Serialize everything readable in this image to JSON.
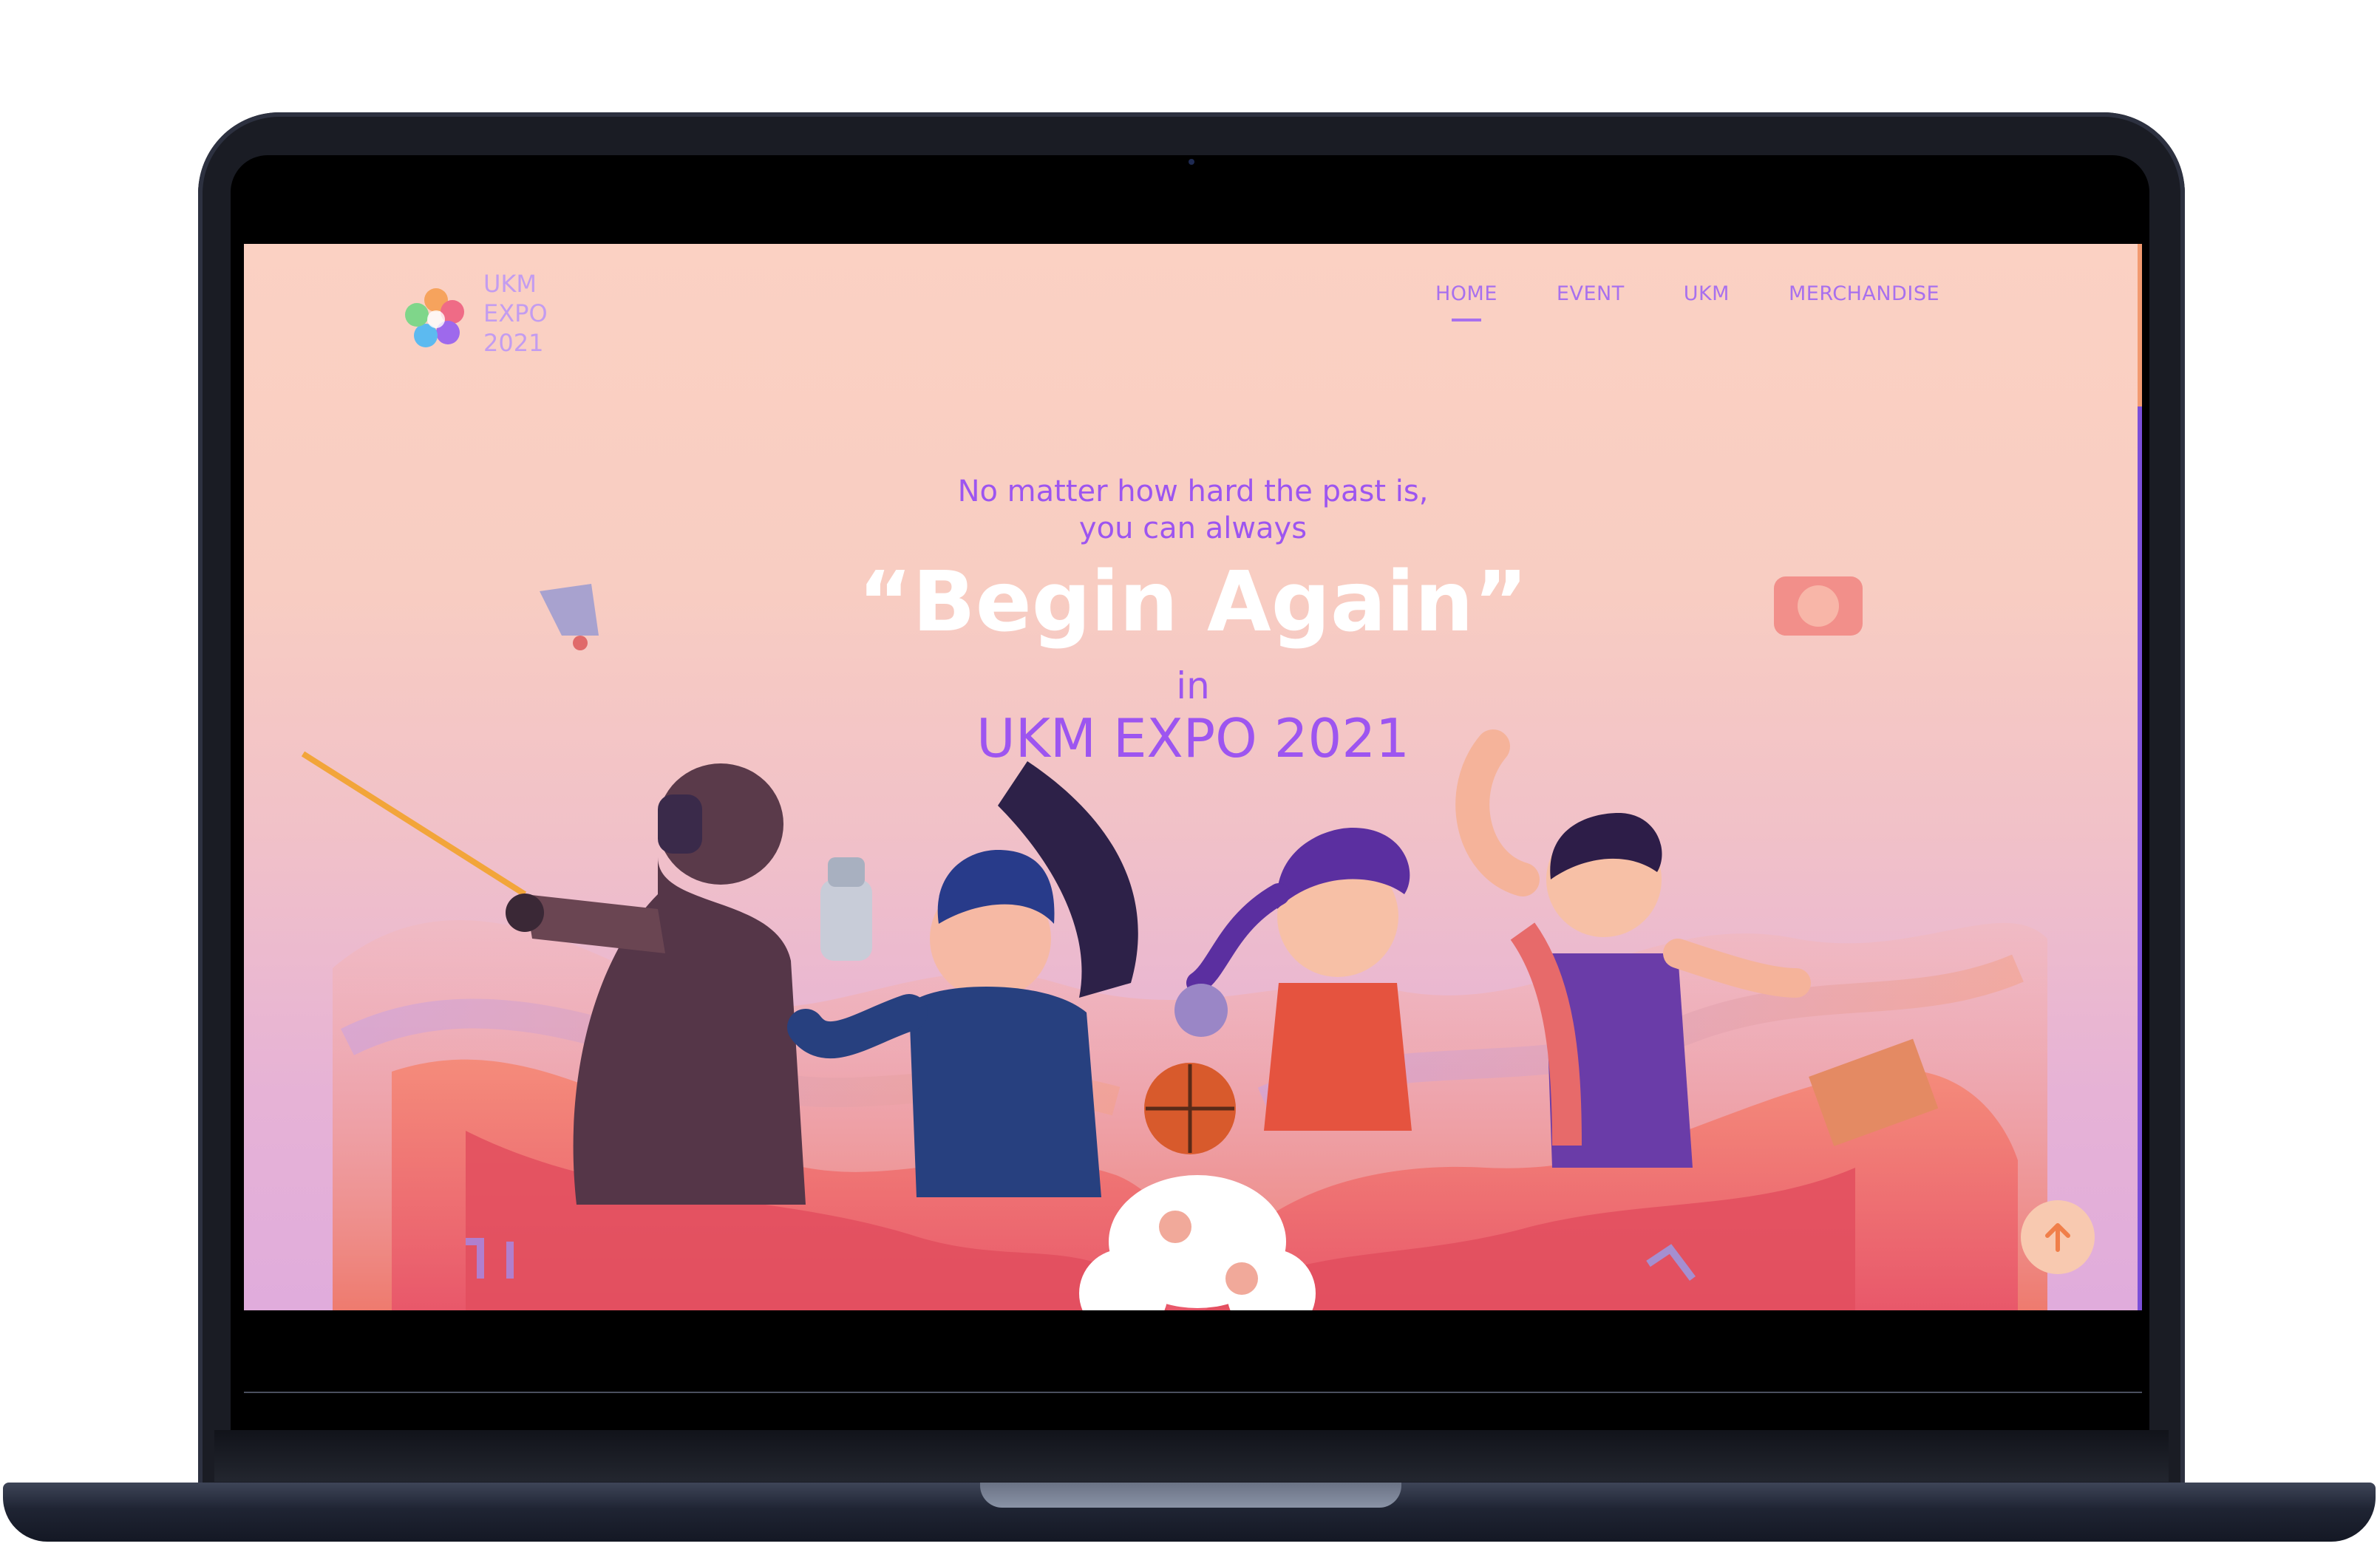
{
  "site": {
    "logo": {
      "line1": "UKM",
      "line2": "EXPO",
      "line3": "2021"
    },
    "nav": [
      {
        "label": "HOME",
        "active": true
      },
      {
        "label": "EVENT",
        "active": false
      },
      {
        "label": "UKM",
        "active": false
      },
      {
        "label": "MERCHANDISE",
        "active": false
      }
    ]
  },
  "hero": {
    "tagline_line1": "No matter how hard the past is,",
    "tagline_line2": "you can always",
    "headline": "“Begin Again”",
    "connector": "in",
    "event_name": "UKM EXPO 2021"
  },
  "colors": {
    "accent_purple": "#9d55f0",
    "nav_purple": "#a870ee",
    "bg_peach": "#fbd1c3",
    "bg_lilac": "#e0acdc",
    "scroll_orange": "#f29a70",
    "back_to_top_bg": "#f8c9b0"
  },
  "icons": {
    "back_to_top": "arrow-up-icon",
    "logo": "flower-logo-icon"
  }
}
